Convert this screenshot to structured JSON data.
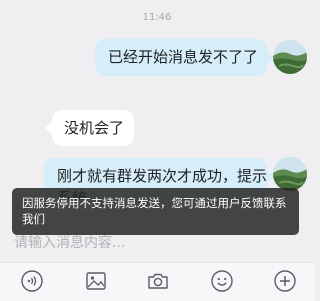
{
  "status": {
    "time": "11:46"
  },
  "messages": [
    {
      "side": "outgoing",
      "text": "已经开始消息发不了了"
    },
    {
      "side": "incoming",
      "text": "没机会了"
    },
    {
      "side": "outgoing",
      "text": "刚才就有群发两次才成功，提示系统"
    }
  ],
  "toast": {
    "text": "因服务停用不支持消息发送，您可通过用户反馈联系我们"
  },
  "composer": {
    "placeholder": "请输入消息内容..."
  },
  "toolbar": {
    "icons": [
      "voice-icon",
      "image-icon",
      "camera-icon",
      "emoji-icon",
      "plus-icon"
    ]
  },
  "colors": {
    "background": "#efeff1",
    "outgoing_bubble": "#d6eef9",
    "incoming_bubble": "#ffffff",
    "toast": "#282828",
    "icon": "#5b5b63"
  }
}
